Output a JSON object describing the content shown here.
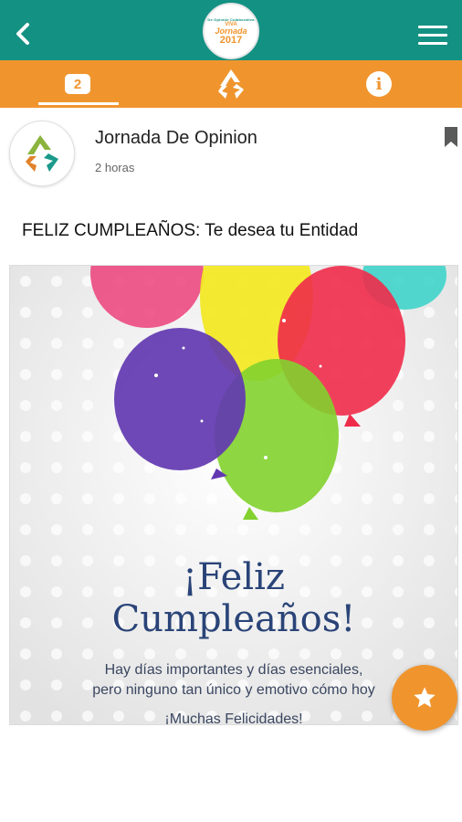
{
  "header": {
    "logo": {
      "line1": "De Opinión Colaborativa",
      "line2": "VIVA",
      "line3": "Jornada",
      "line4": "2017"
    }
  },
  "tabs": [
    {
      "badge": "2",
      "active": true,
      "icon": "notifications-count"
    },
    {
      "icon": "recycle-logo-icon"
    },
    {
      "label": "i",
      "icon": "info-icon"
    }
  ],
  "post": {
    "author": "Jornada De Opinion",
    "time": "2 horas",
    "title": "FELIZ CUMPLEAÑOS: Te desea tu Entidad",
    "card": {
      "heading_line1": "¡Feliz",
      "heading_line2": "Cumpleaños!",
      "text_line1": "Hay días importantes y días esenciales,",
      "text_line2": "pero ninguno tan único y emotivo cómo hoy",
      "text_line3": "¡Muchas Felicidades!"
    }
  },
  "colors": {
    "teal": "#139183",
    "orange": "#f0952e",
    "heading_blue": "#2a4478"
  },
  "fab": {
    "icon": "star-icon"
  }
}
